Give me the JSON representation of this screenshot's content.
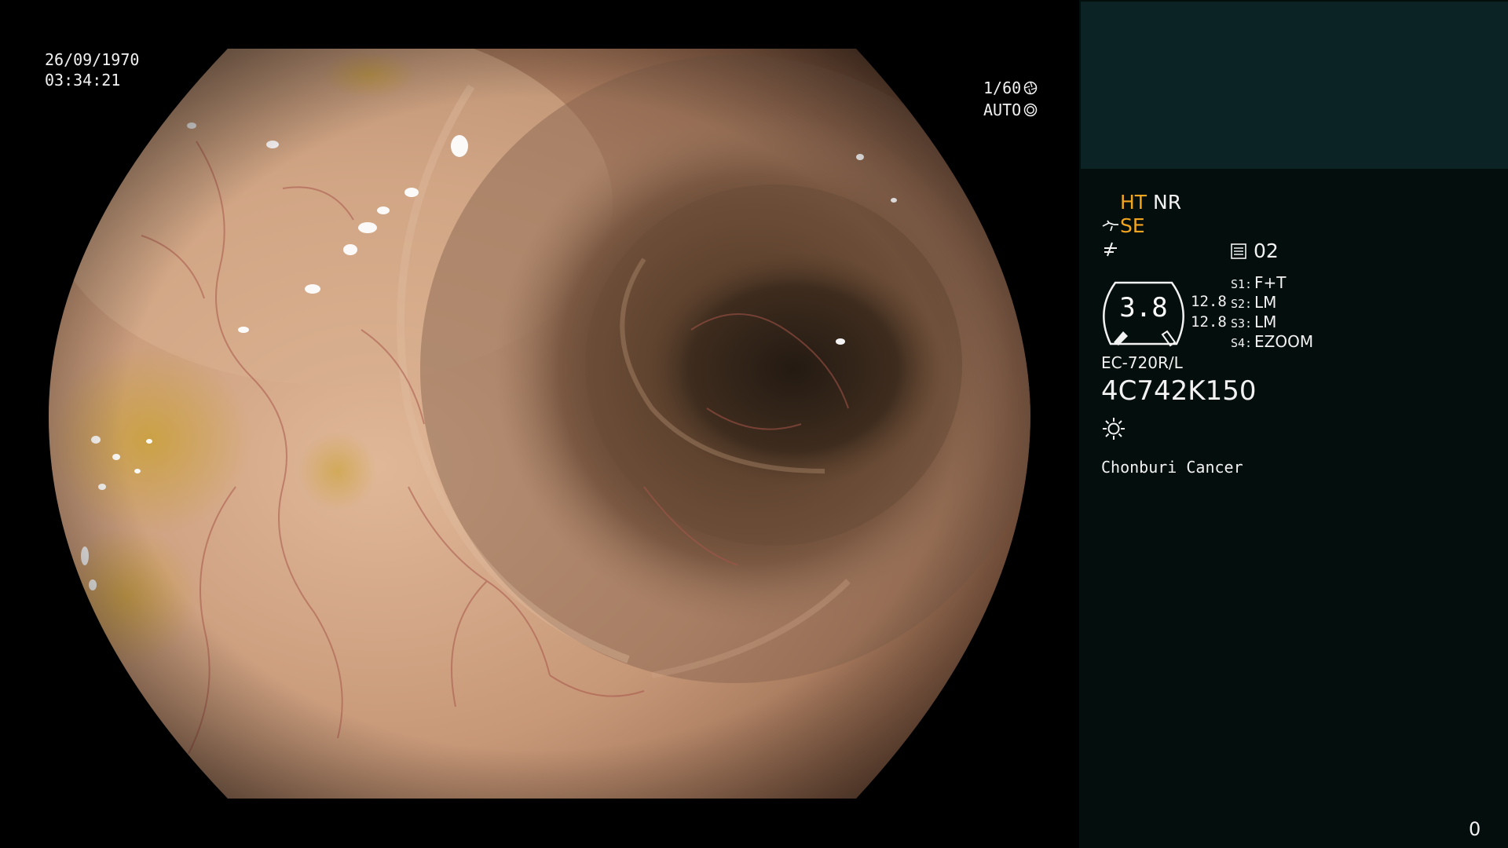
{
  "image_overlay": {
    "date": "26/09/1970",
    "time": "03:34:21",
    "shutter": "1/60",
    "exposure_mode": "AUTO"
  },
  "panel": {
    "mode_ht": "HT",
    "mode_nr": "NR",
    "mode_se": "SE",
    "memory_value": "02",
    "gauge_value": "3.8",
    "gauge_a": "12.8",
    "gauge_b": "12.8",
    "switches": [
      {
        "key": "S1:",
        "value": "F+T"
      },
      {
        "key": "S2:",
        "value": "LM"
      },
      {
        "key": "S3:",
        "value": "LM"
      },
      {
        "key": "S4:",
        "value": "EZOOM"
      }
    ],
    "scope_model": "EC-720R/L",
    "scope_serial": "4C742K150",
    "institution": "Chonburi Cancer",
    "frame_counter": "0"
  },
  "colors": {
    "accent_orange": "#f4a51e",
    "panel_bg": "#040e0d",
    "panel_top_bg": "#0b2324"
  },
  "icons": [
    "shutter-icon",
    "auto-exposure-icon",
    "scope-icon",
    "flat-icon",
    "memory-icon",
    "light-source-icon",
    "gauge-icon"
  ]
}
